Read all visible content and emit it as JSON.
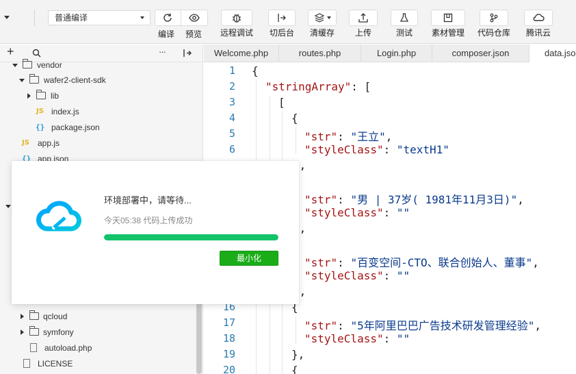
{
  "toolbar": {
    "mode_value": "普通编译",
    "buttons": [
      {
        "label": "编译",
        "icon": "refresh-icon"
      },
      {
        "label": "预览",
        "icon": "eye-icon"
      },
      {
        "label": "远程调试",
        "icon": "bug-icon"
      },
      {
        "label": "切后台",
        "icon": "switch-background-icon"
      },
      {
        "label": "清缓存",
        "icon": "layers-icon"
      },
      {
        "label": "上传",
        "icon": "upload-icon"
      },
      {
        "label": "测试",
        "icon": "flask-icon"
      },
      {
        "label": "素材管理",
        "icon": "asset-icon"
      },
      {
        "label": "代码仓库",
        "icon": "git-branch-icon"
      },
      {
        "label": "腾讯云",
        "icon": "cloud-icon"
      }
    ]
  },
  "sidebar": {
    "header_icons": [
      "add-icon",
      "search-icon",
      "more-icon",
      "collapse-icon"
    ],
    "tree": [
      {
        "label": "vendor",
        "type": "folder",
        "state": "open"
      },
      {
        "label": "wafer2-client-sdk",
        "type": "folder",
        "state": "open"
      },
      {
        "label": "lib",
        "type": "folder",
        "state": "closed"
      },
      {
        "label": "index.js",
        "type": "js"
      },
      {
        "label": "package.json",
        "type": "json"
      },
      {
        "label": "app.js",
        "type": "js"
      },
      {
        "label": "app.json",
        "type": "json"
      },
      {
        "label": "qcloud",
        "type": "folder",
        "state": "closed"
      },
      {
        "label": "symfony",
        "type": "folder",
        "state": "closed"
      },
      {
        "label": "autoload.php",
        "type": "php"
      },
      {
        "label": "LICENSE",
        "type": "file"
      }
    ]
  },
  "tabs": [
    "Welcome.php",
    "routes.php",
    "Login.php",
    "composer.json",
    "data.json"
  ],
  "editor": {
    "active_file": "data.json",
    "line_numbers": [
      "1",
      "2",
      "3",
      "4",
      "5",
      "6",
      "16",
      "17",
      "18",
      "19",
      "20"
    ],
    "strings": {
      "key_stringArray": "\"stringArray\"",
      "key_str": "\"str\"",
      "key_styleClass": "\"styleClass\"",
      "v1": "\"王立\"",
      "v1_class": "\"textH1\"",
      "v2": "\"男 | 37岁( 1981年11月3日)\"",
      "v3": "\"百变空间-CTO、联合创始人、董事\"",
      "v4": "\"5年阿里巴巴广告技术研发管理经验\"",
      "empty": "\"\""
    }
  },
  "dialog": {
    "title": "环境部署中，请等待...",
    "subtitle": "今天05:38 代码上传成功",
    "progress": 1.0,
    "button": "最小化"
  }
}
